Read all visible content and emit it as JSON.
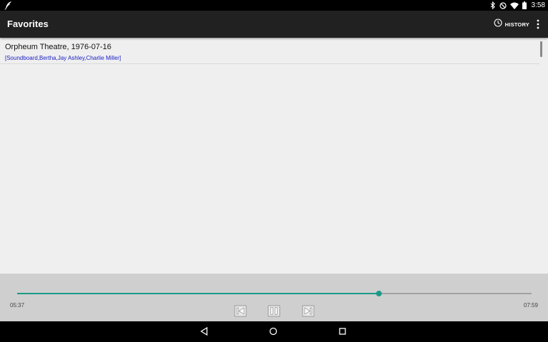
{
  "status_bar": {
    "time": "3:58",
    "icons": [
      "feather-icon",
      "bluetooth-icon",
      "do-not-disturb-icon",
      "wifi-icon",
      "battery-icon"
    ]
  },
  "app_bar": {
    "title": "Favorites",
    "history_label": "HISTORY",
    "icons": [
      "history-clock-icon",
      "overflow-menu-icon"
    ]
  },
  "favorites": [
    {
      "title": "Orpheum Theatre, 1976-07-16",
      "subtitle": "[Soundboard,Bertha,Jay Ashley,Charlie Miller]"
    }
  ],
  "player": {
    "elapsed": "05:37",
    "total": "07:59",
    "progress_fraction": 0.7035,
    "controls": [
      "skip-previous-icon",
      "pause-icon",
      "skip-next-icon"
    ],
    "accent_color": "#1b9a8a"
  },
  "nav_bar": {
    "buttons": [
      "back-icon",
      "home-icon",
      "recents-icon"
    ]
  },
  "colors": {
    "status_bar": "#000000",
    "app_bar": "#212121",
    "background": "#efefef",
    "player_bg": "#cfcfcf",
    "subtitle_link": "#1c22c4"
  }
}
